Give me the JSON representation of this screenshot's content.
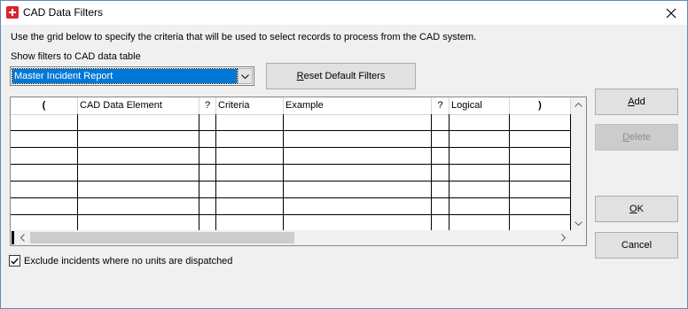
{
  "window": {
    "title": "CAD Data Filters",
    "icon": "swiss-cross-icon",
    "close_icon": "close-icon"
  },
  "instructions": "Use the grid below to specify the criteria that will be used to select records to process from the CAD system.",
  "table_select": {
    "label": "Show filters to CAD data table",
    "value": "Master Incident Report"
  },
  "buttons": {
    "reset_underlined": "R",
    "reset_rest": "eset Default Filters",
    "add_underlined": "A",
    "add_rest": "dd",
    "delete_underlined": "D",
    "delete_rest": "elete",
    "ok_underlined": "O",
    "ok_rest": "K",
    "cancel": "Cancel"
  },
  "grid": {
    "columns": [
      "(",
      "CAD Data Element",
      "?",
      "Criteria",
      "Example",
      "?",
      "Logical",
      ")"
    ],
    "row_count": 7
  },
  "checkbox": {
    "label": "Exclude incidents where no units are dispatched",
    "checked": true
  },
  "colors": {
    "selection": "#0078d7",
    "window_bg": "#f0f0f0",
    "icon_red": "#d7262e"
  }
}
